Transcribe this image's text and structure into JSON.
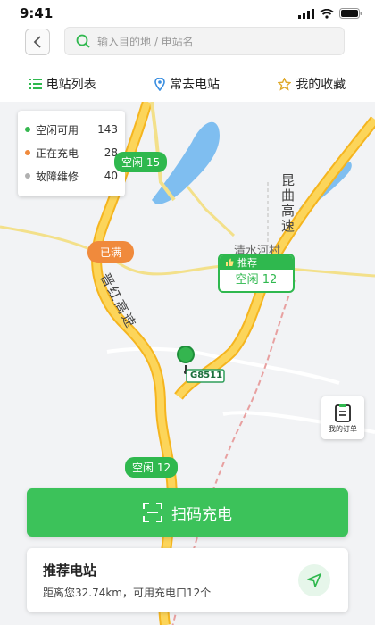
{
  "status": {
    "time": "9:41"
  },
  "search": {
    "placeholder": "输入目的地 / 电站名"
  },
  "tabs": [
    {
      "label": "电站列表",
      "icon": "list-icon"
    },
    {
      "label": "常去电站",
      "icon": "location-pin-icon"
    },
    {
      "label": "我的收藏",
      "icon": "star-icon"
    }
  ],
  "legend": [
    {
      "label": "空闲可用",
      "count": "143",
      "color": "#35b74f"
    },
    {
      "label": "正在充电",
      "count": "28",
      "color": "#f08a3c"
    },
    {
      "label": "故障维修",
      "count": "40",
      "color": "#b0b0b0"
    }
  ],
  "map": {
    "markers": [
      {
        "text": "空闲 15",
        "status": "idle"
      },
      {
        "text": "已满",
        "status": "full"
      },
      {
        "text": "空闲 12",
        "status": "idle"
      }
    ],
    "recommend": {
      "tag": "推荐",
      "text": "空闲 12"
    },
    "road_labels": [
      "晋红高速",
      "昆曲高速",
      "清水河村"
    ],
    "highway_shield": "G8511"
  },
  "orders": {
    "label": "我的订单"
  },
  "scan": {
    "label": "扫码充电"
  },
  "recommend_card": {
    "title": "推荐电站",
    "desc": "距离您32.74km，可用充电口12个"
  },
  "colors": {
    "accent": "#3cc25a",
    "road": "#f5c33a",
    "water": "#7fbef0"
  }
}
